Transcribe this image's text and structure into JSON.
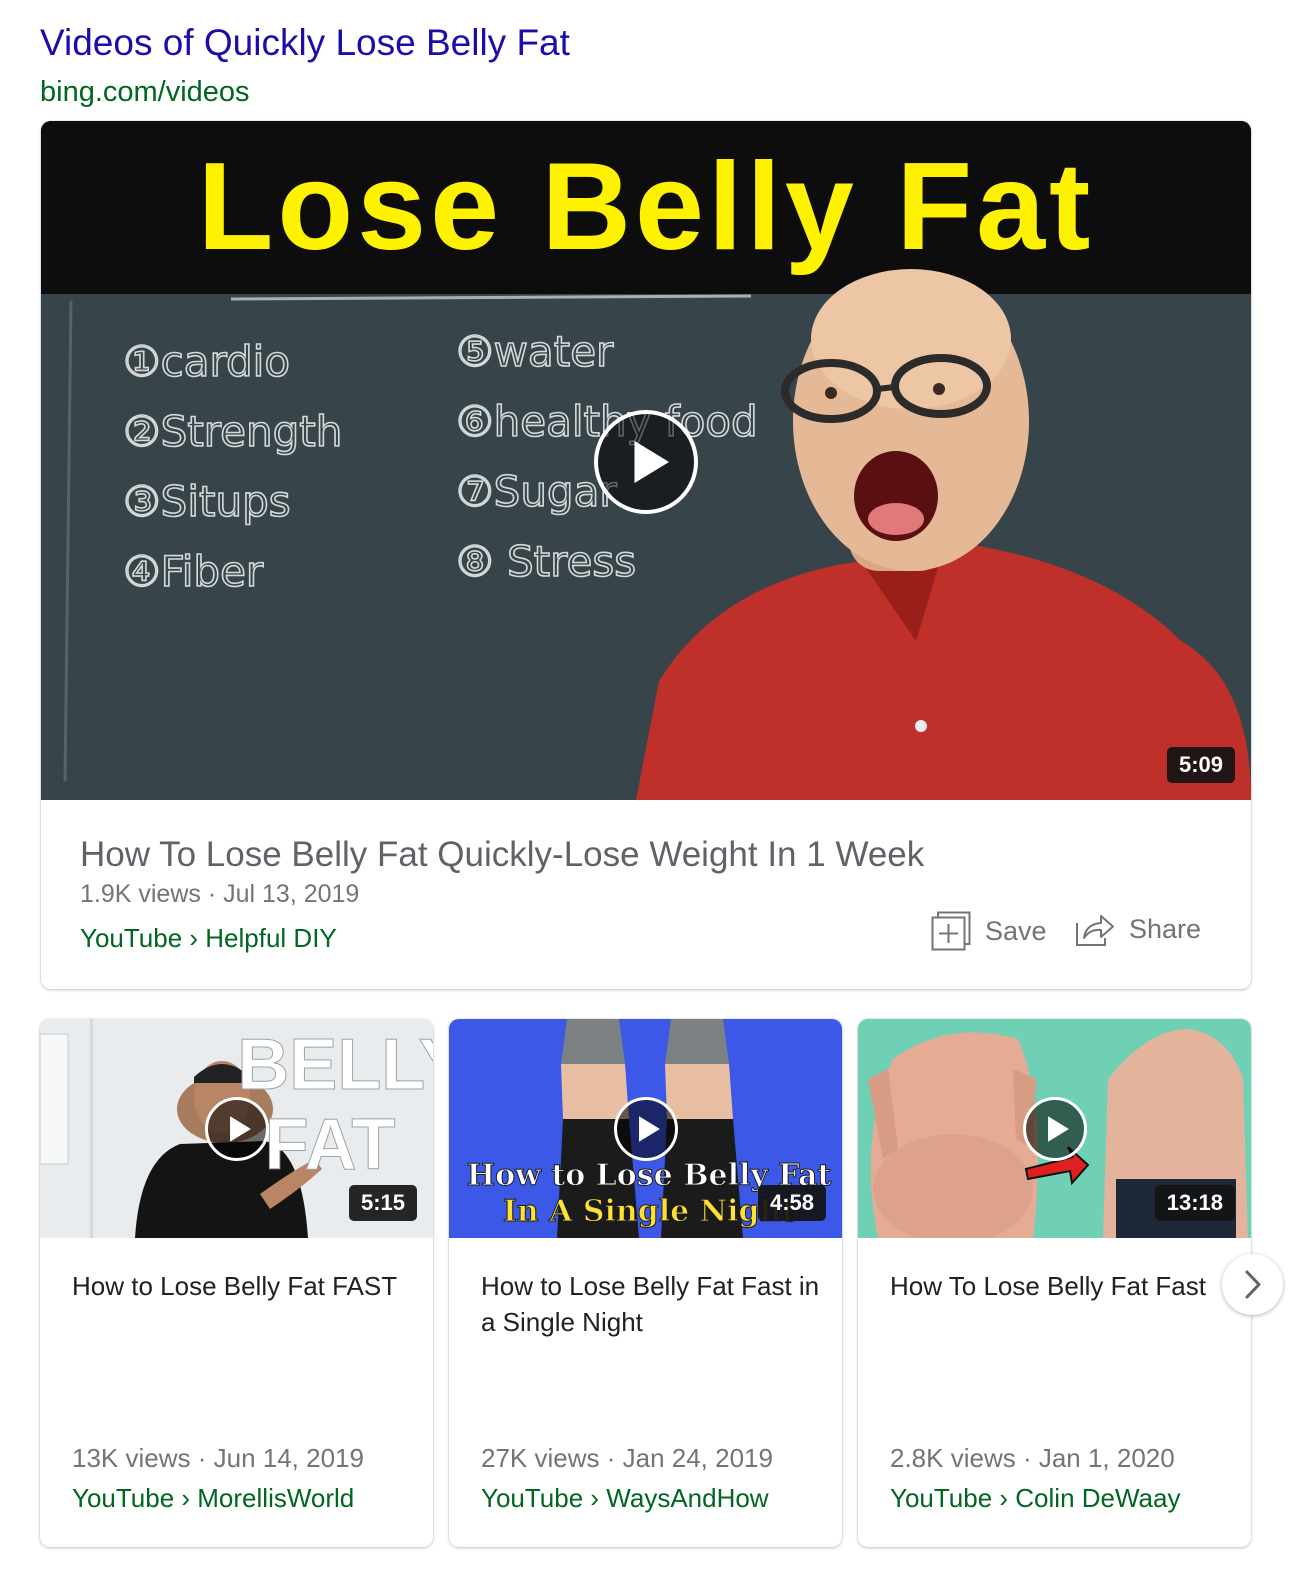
{
  "header": {
    "title": "Videos of Quickly Lose Belly Fat",
    "url": "bing.com/videos"
  },
  "main_video": {
    "thumbnail_banner": "Lose Belly Fat",
    "board_left": [
      "①cardio",
      "②Strength",
      "③Situps",
      "④Fiber"
    ],
    "board_right": [
      "⑤water",
      "⑥healthy food",
      "⑦Sugar",
      "⑧ Stress"
    ],
    "duration": "5:09",
    "title": "How To Lose Belly Fat Quickly-Lose Weight In 1 Week",
    "meta": "1.9K views · Jul 13, 2019",
    "source": "YouTube › Helpful DIY",
    "save_label": "Save",
    "share_label": "Share"
  },
  "videos": [
    {
      "thumb_text_1": "BELLY",
      "thumb_text_2": "FAT",
      "duration": "5:15",
      "title": "How to Lose Belly Fat FAST",
      "meta": "13K views · Jun 14, 2019",
      "source": "YouTube › MorellisWorld"
    },
    {
      "thumb_text_1": "How to Lose Belly Fat",
      "thumb_text_2": "In A Single Night",
      "duration": "4:58",
      "title": "How to Lose Belly Fat Fast in a Single Night",
      "meta": "27K views · Jan 24, 2019",
      "source": "YouTube › WaysAndHow"
    },
    {
      "duration": "13:18",
      "title": "How To Lose Belly Fat Fast",
      "meta": "2.8K views · Jan 1, 2020",
      "source": "YouTube › Colin DeWaay"
    }
  ],
  "colors": {
    "title_link": "#1a0dab",
    "url_green": "#006621",
    "banner_yellow": "#fff200",
    "chalkboard": "#37444a",
    "shirt_red": "#c0302a"
  },
  "icons": [
    "play-icon",
    "save-icon",
    "share-icon",
    "chevron-right-icon"
  ]
}
